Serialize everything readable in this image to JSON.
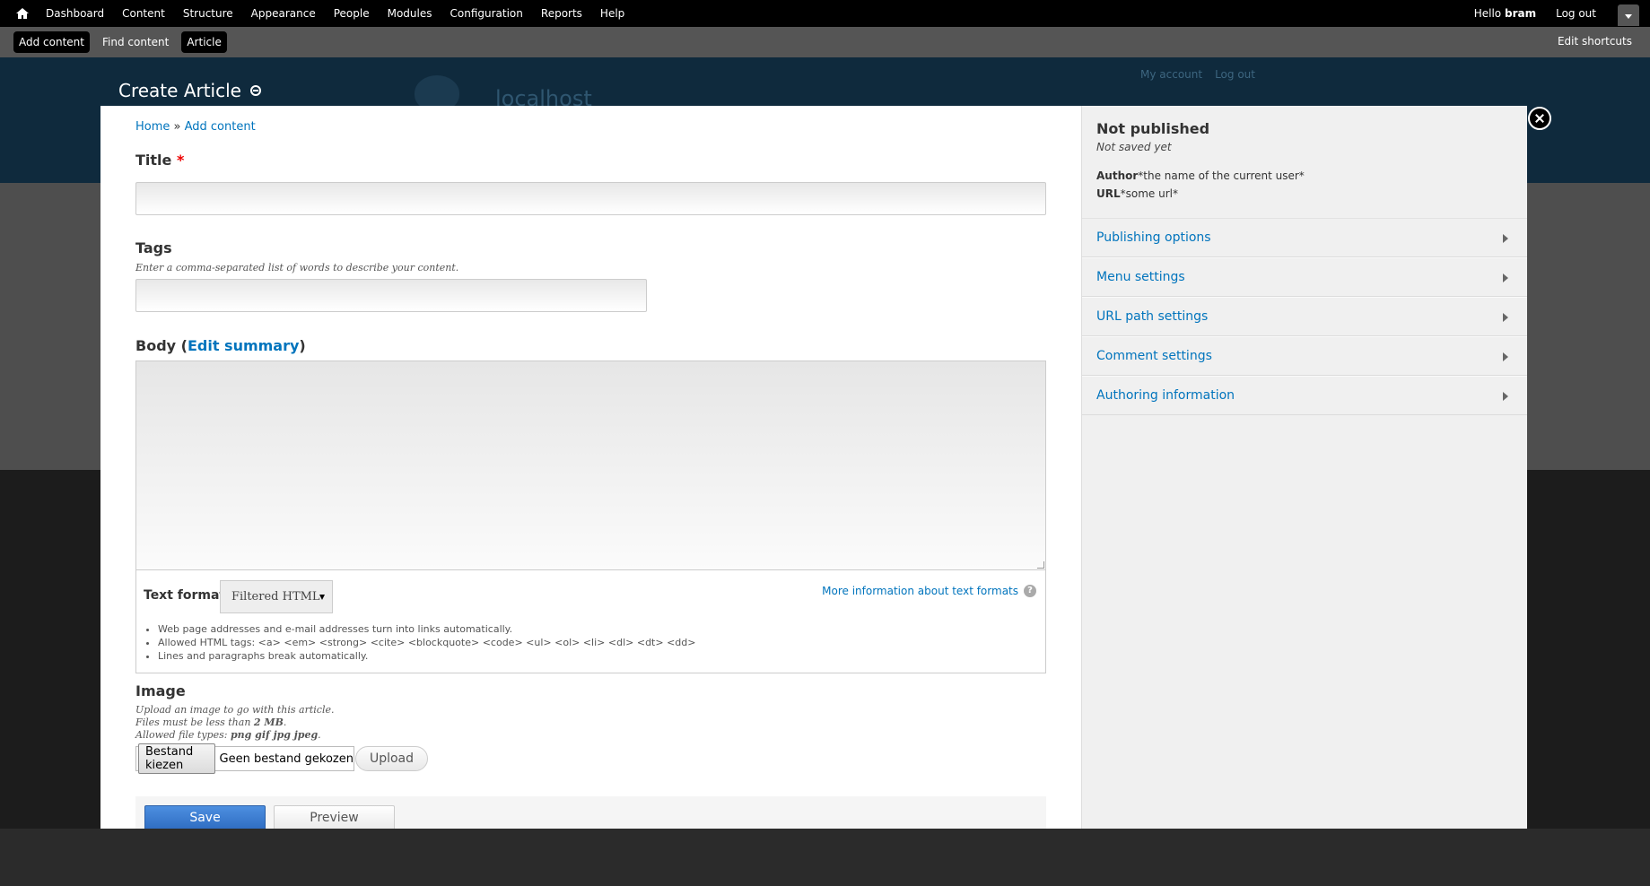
{
  "toolbar": {
    "menu": [
      "Dashboard",
      "Content",
      "Structure",
      "Appearance",
      "People",
      "Modules",
      "Configuration",
      "Reports",
      "Help"
    ],
    "hello": "Hello",
    "user": "bram",
    "logout": "Log out"
  },
  "shortcuts": {
    "items": [
      "Add content",
      "Find content",
      "Article"
    ],
    "edit": "Edit shortcuts"
  },
  "background": {
    "site_name": "localhost",
    "my_account": "My account",
    "log_out": "Log out"
  },
  "overlay": {
    "title": "Create Article"
  },
  "breadcrumb": {
    "home": "Home",
    "sep": " » ",
    "add_content": "Add content"
  },
  "form": {
    "title_label": "Title",
    "required_mark": "*",
    "tags_label": "Tags",
    "tags_desc": "Enter a comma-separated list of words to describe your content.",
    "body_label": "Body (",
    "body_edit_summary": "Edit summary",
    "body_close": ")",
    "text_format_label": "Text format",
    "text_format_value": "Filtered HTML",
    "text_format_more": "More information about text formats",
    "text_format_tips": [
      "Web page addresses and e-mail addresses turn into links automatically.",
      "Allowed HTML tags: <a> <em> <strong> <cite> <blockquote> <code> <ul> <ol> <li> <dl> <dt> <dd>",
      "Lines and paragraphs break automatically."
    ],
    "image_label": "Image",
    "image_desc1": "Upload an image to go with this article.",
    "image_desc2_pre": "Files must be less than ",
    "image_desc2_size": "2 MB",
    "image_desc2_post": ".",
    "image_desc3_pre": "Allowed file types: ",
    "image_desc3_types": "png gif jpg jpeg",
    "image_desc3_post": ".",
    "file_choose": "Bestand kiezen",
    "file_none": "Geen bestand gekozen",
    "upload": "Upload",
    "save": "Save",
    "preview": "Preview"
  },
  "sidebar": {
    "status": "Not published",
    "saved": "Not saved yet",
    "author_label": "Author",
    "author_value": "*the name of the current user*",
    "url_label": "URL",
    "url_value": "*some url*",
    "items": [
      "Publishing options",
      "Menu settings",
      "URL path settings",
      "Comment settings",
      "Authoring information"
    ]
  },
  "colors": {
    "link": "#0074bd",
    "save_button": "#3a7bd5",
    "toolbar": "#000000"
  }
}
